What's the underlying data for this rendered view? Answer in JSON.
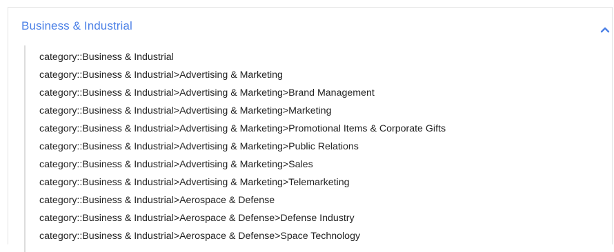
{
  "panel": {
    "title": "Business & Industrial",
    "expanded": true,
    "toggle_icon": "chevron-up-icon",
    "accent_color": "#4a7fe6"
  },
  "categories": [
    "category::Business & Industrial",
    "category::Business & Industrial>Advertising & Marketing",
    "category::Business & Industrial>Advertising & Marketing>Brand Management",
    "category::Business & Industrial>Advertising & Marketing>Marketing",
    "category::Business & Industrial>Advertising & Marketing>Promotional Items & Corporate Gifts",
    "category::Business & Industrial>Advertising & Marketing>Public Relations",
    "category::Business & Industrial>Advertising & Marketing>Sales",
    "category::Business & Industrial>Advertising & Marketing>Telemarketing",
    "category::Business & Industrial>Aerospace & Defense",
    "category::Business & Industrial>Aerospace & Defense>Defense Industry",
    "category::Business & Industrial>Aerospace & Defense>Space Technology"
  ]
}
